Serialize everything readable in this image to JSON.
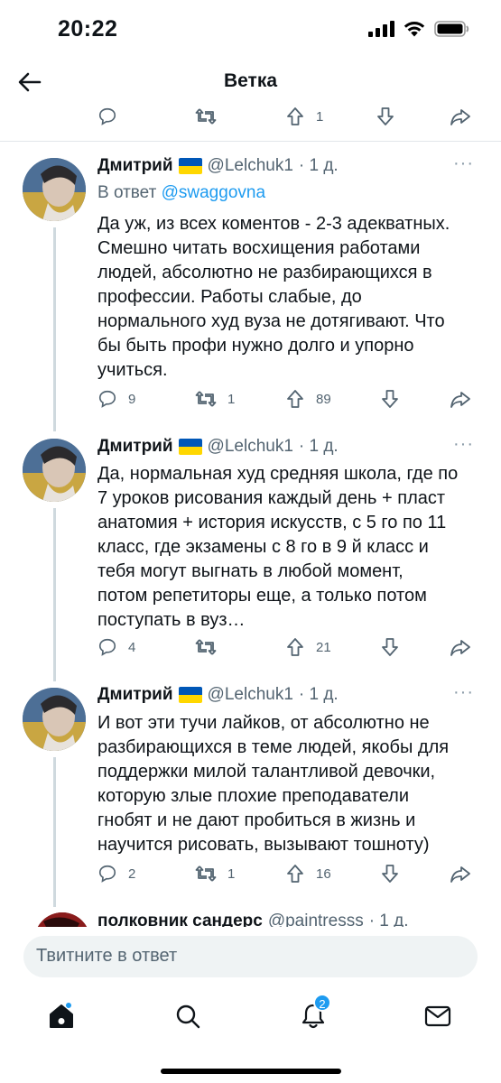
{
  "status_bar": {
    "time": "20:22"
  },
  "header": {
    "title": "Ветка"
  },
  "top_actions": {
    "retweets": "",
    "likes": "1"
  },
  "tweets": [
    {
      "name": "Дмитрий",
      "handle": "@Lelchuk1",
      "time": "· 1 д.",
      "reply_label": "В ответ",
      "reply_handle": "@swaggovna",
      "text": "Да уж, из всех коментов - 2-3 адекватных.\nСмешно читать восхищения работами\nлюдей, абсолютно не разбирающихся в\nпрофессии. Работы слабые, до\nнормального худ вуза не дотягивают. Что\nбы быть профи нужно долго и упорно\nучиться.",
      "replies": "9",
      "retweets": "1",
      "likes": "89"
    },
    {
      "name": "Дмитрий",
      "handle": "@Lelchuk1",
      "time": "· 1 д.",
      "text": "Да, нормальная худ средняя школа, где по\n7 уроков рисования каждый день + пласт\nанатомия + история искусств, с 5 го по 11\nкласс, где экзамены с 8 го в 9 й класс и\nтебя могут выгнать в любой момент,\nпотом репетиторы еще, а только потом\nпоступать в вуз…",
      "replies": "4",
      "retweets": "",
      "likes": "21"
    },
    {
      "name": "Дмитрий",
      "handle": "@Lelchuk1",
      "time": "· 1 д.",
      "text": "И вот эти тучи лайков, от абсолютно не\nразбирающихся в теме людей, якобы для\nподдержки милой талантливой девочки,\nкоторую злые плохие преподаватели\nгнобят и не дают пробиться  в жизнь и\nнаучится рисовать, вызывают тошноту)",
      "replies": "2",
      "retweets": "1",
      "likes": "16"
    },
    {
      "name": "полковник сандерс",
      "handle": "@paintresss",
      "time": "· 1 д."
    }
  ],
  "compose": {
    "placeholder": "Твитните в ответ"
  },
  "tabbar": {
    "notifications_badge": "2"
  },
  "colors": {
    "accent": "#1d9bf0",
    "muted": "#536471",
    "flag_blue": "#0057b7",
    "flag_yellow": "#ffd700"
  }
}
